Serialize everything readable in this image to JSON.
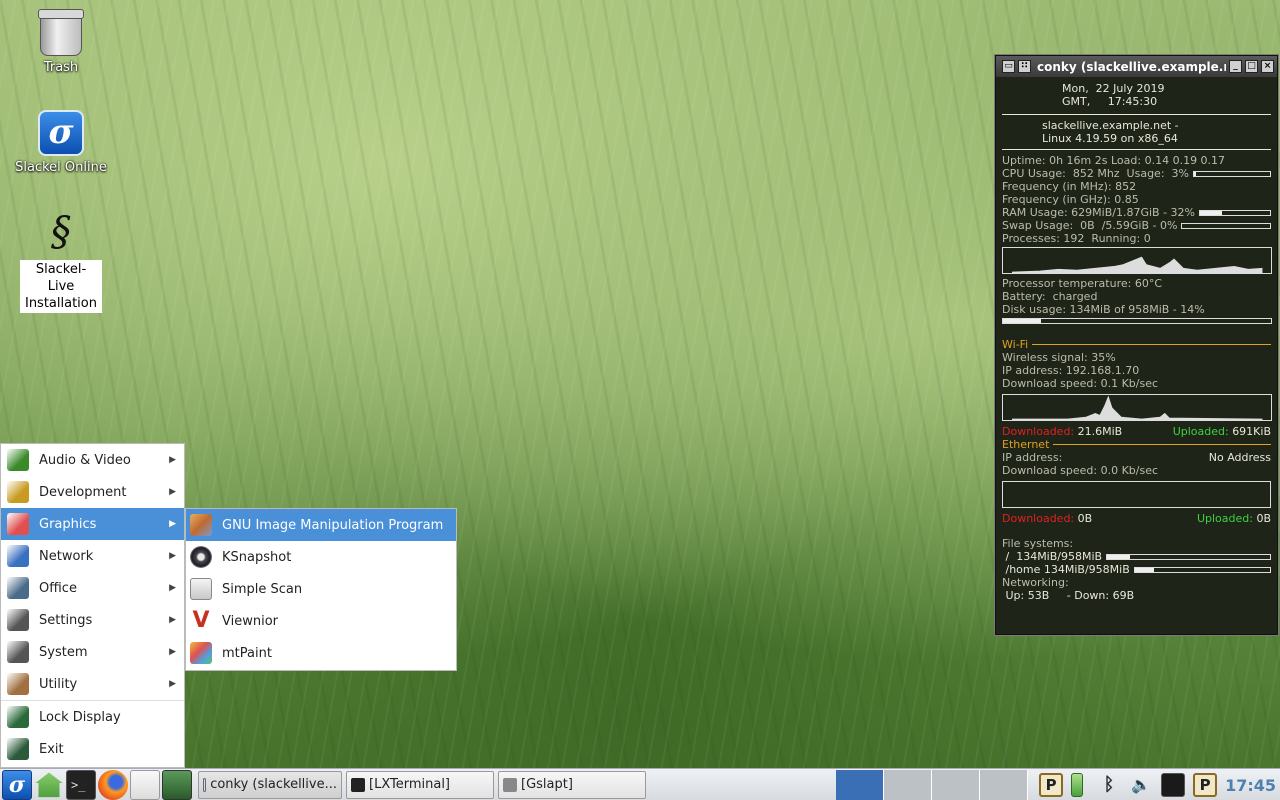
{
  "desktop": {
    "icons": [
      {
        "label": "Trash"
      },
      {
        "label": "Slackel Online"
      },
      {
        "label": "Slackel-Live Installation"
      }
    ]
  },
  "conky": {
    "title": "conky (slackellive.example.net)",
    "date_line1": "Mon,  22 July 2019",
    "date_line2": "GMT,     17:45:30",
    "host_line1": "slackellive.example.net -",
    "host_line2": "Linux 4.19.59 on x86_64",
    "uptime": "Uptime: 0h 16m 2s Load: 0.14 0.19 0.17",
    "cpu_usage_label": "CPU Usage:  852 Mhz  Usage:  3%",
    "cpu_usage_pct": 3,
    "freq_mhz": "Frequency (in MHz): 852",
    "freq_ghz": "Frequency (in GHz): 0.85",
    "ram_label": "RAM Usage: 629MiB/1.87GiB - 32%",
    "ram_pct": 32,
    "swap_label": "Swap Usage:  0B  /5.59GiB - 0%",
    "swap_pct": 0,
    "processes": "Processes: 192  Running: 0",
    "temp": "Processor temperature: 60°C",
    "battery": "Battery:  charged",
    "disk_label": "Disk usage: 134MiB of 958MiB - 14%",
    "disk_pct": 14,
    "wifi_header": "Wi-Fi",
    "wifi_signal": "Wireless signal: 35%",
    "wifi_ip": "IP address: 192.168.1.70",
    "wifi_dl_speed": "Download speed: 0.1 Kb/sec",
    "wifi_downloaded_label": "Downloaded:",
    "wifi_downloaded_value": "21.6MiB",
    "wifi_uploaded_label": "Uploaded:",
    "wifi_uploaded_value": "691KiB",
    "eth_header": "Ethernet",
    "eth_ip_label": "IP address:",
    "eth_ip_value": "No Address",
    "eth_dl_speed": "Download speed: 0.0 Kb/sec",
    "eth_downloaded_label": "Downloaded:",
    "eth_downloaded_value": "0B",
    "eth_uploaded_label": "Uploaded:",
    "eth_uploaded_value": "0B",
    "fs_header": "File systems:",
    "fs_root": " /  134MiB/958MiB",
    "fs_root_pct": 14,
    "fs_home": " /home 134MiB/958MiB",
    "fs_home_pct": 14,
    "net_header": "Networking:",
    "net_line": " Up: 53B     - Down: 69B"
  },
  "menu": {
    "items": [
      {
        "label": "Audio & Video",
        "icon": "audio-video-icon",
        "color": "#3a8a2a"
      },
      {
        "label": "Development",
        "icon": "development-icon",
        "color": "#c89a20"
      },
      {
        "label": "Graphics",
        "icon": "graphics-icon",
        "color": "#e05050"
      },
      {
        "label": "Network",
        "icon": "network-icon",
        "color": "#3a70c0"
      },
      {
        "label": "Office",
        "icon": "office-icon",
        "color": "#4a6a8a"
      },
      {
        "label": "Settings",
        "icon": "settings-icon",
        "color": "#555555"
      },
      {
        "label": "System",
        "icon": "system-icon",
        "color": "#555555"
      },
      {
        "label": "Utility",
        "icon": "utility-icon",
        "color": "#a07040"
      },
      {
        "label": "Lock Display",
        "icon": "lock-display-icon",
        "color": "#2a6a3a"
      },
      {
        "label": "Exit",
        "icon": "exit-icon",
        "color": "#2a5a3a"
      }
    ],
    "graphics_submenu": [
      {
        "label": "GNU Image Manipulation Program",
        "icon": "gimp-icon"
      },
      {
        "label": "KSnapshot",
        "icon": "ksnapshot-icon"
      },
      {
        "label": "Simple Scan",
        "icon": "simple-scan-icon"
      },
      {
        "label": "Viewnior",
        "icon": "viewnior-icon"
      },
      {
        "label": "mtPaint",
        "icon": "mtpaint-icon"
      }
    ]
  },
  "taskbar": {
    "tasks": [
      {
        "label": "conky (slackellive..."
      },
      {
        "label": "[LXTerminal]"
      },
      {
        "label": "[Gslapt]"
      }
    ],
    "clock": "17:45"
  }
}
